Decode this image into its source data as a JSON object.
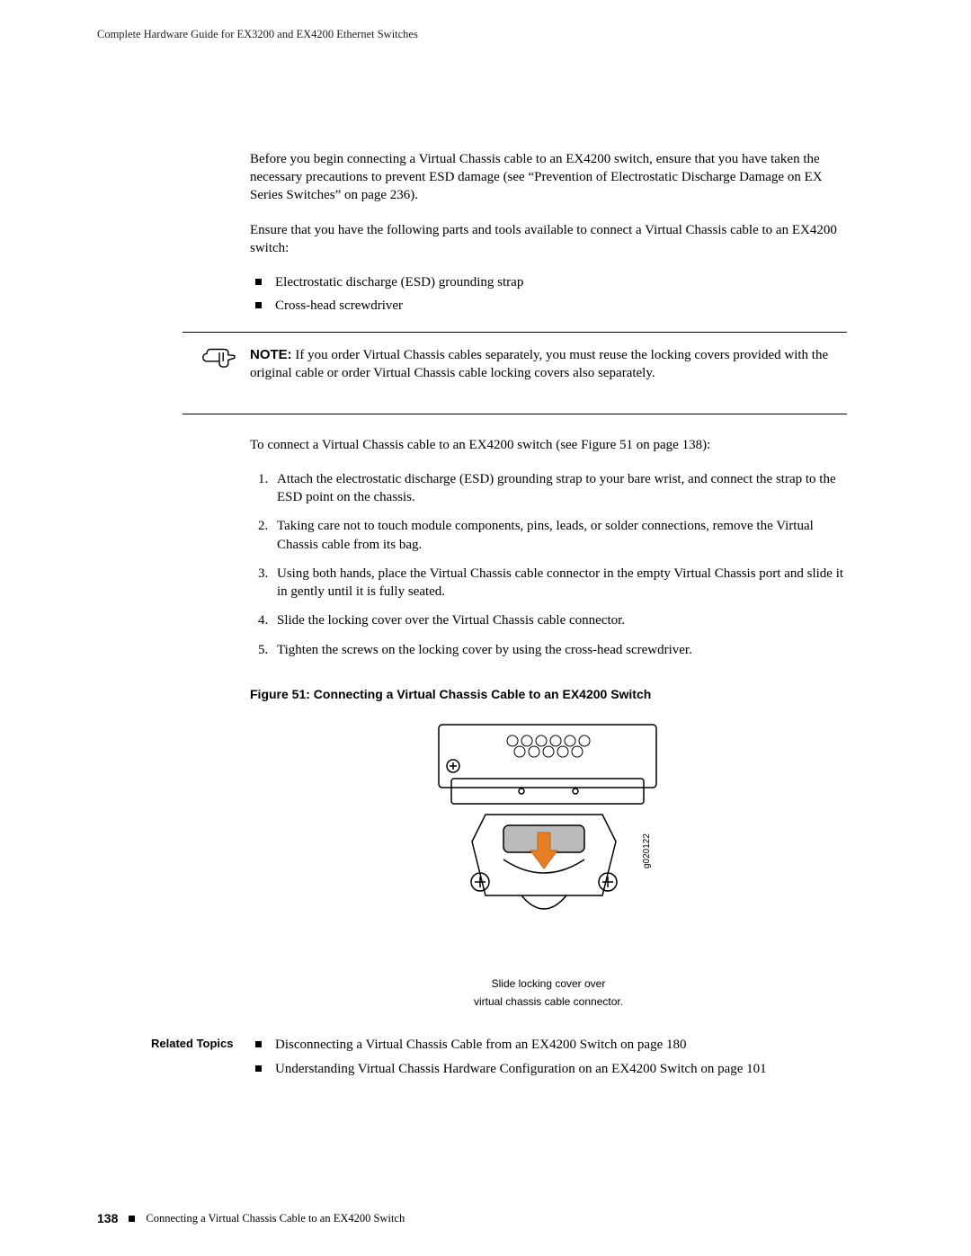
{
  "header": {
    "running": "Complete Hardware Guide for EX3200 and EX4200 Ethernet Switches"
  },
  "intro": {
    "p1": "Before you begin connecting a Virtual Chassis cable to an EX4200 switch, ensure that you have taken the necessary precautions to prevent ESD damage (see “Prevention of Electrostatic Discharge Damage on EX Series Switches” on page 236).",
    "p2": "Ensure that you have the following parts and tools available to connect a Virtual Chassis cable to an EX4200 switch:"
  },
  "tools": [
    "Electrostatic discharge (ESD) grounding strap",
    "Cross-head screwdriver"
  ],
  "note": {
    "label": "NOTE:",
    "text": "If you order Virtual Chassis cables separately, you must reuse the locking covers provided with the original cable or order Virtual Chassis cable locking covers also separately."
  },
  "procedure_lead": "To connect a Virtual Chassis cable to an EX4200 switch (see Figure 51 on page 138):",
  "steps": [
    "Attach the electrostatic discharge (ESD) grounding strap to your bare wrist, and connect the strap to the ESD point on the chassis.",
    "Taking care not to touch module components, pins, leads, or solder connections, remove the Virtual Chassis cable from its bag.",
    "Using both hands, place the Virtual Chassis cable connector in the empty Virtual Chassis port and slide it in gently until it is fully seated.",
    "Slide the locking cover over the Virtual Chassis cable connector.",
    "Tighten the screws on the locking cover by using the cross-head screwdriver."
  ],
  "figure": {
    "caption": "Figure 51: Connecting a Virtual Chassis Cable to an EX4200 Switch",
    "callout_line1": "Slide locking cover over",
    "callout_line2": "virtual chassis cable connector.",
    "artno": "g020122"
  },
  "related": {
    "label": "Related Topics",
    "items": [
      "Disconnecting a Virtual Chassis Cable from an EX4200 Switch on page 180",
      "Understanding Virtual Chassis Hardware Configuration on an EX4200 Switch on page 101"
    ]
  },
  "footer": {
    "pagenum": "138",
    "section": "Connecting a Virtual Chassis Cable to an EX4200 Switch"
  }
}
